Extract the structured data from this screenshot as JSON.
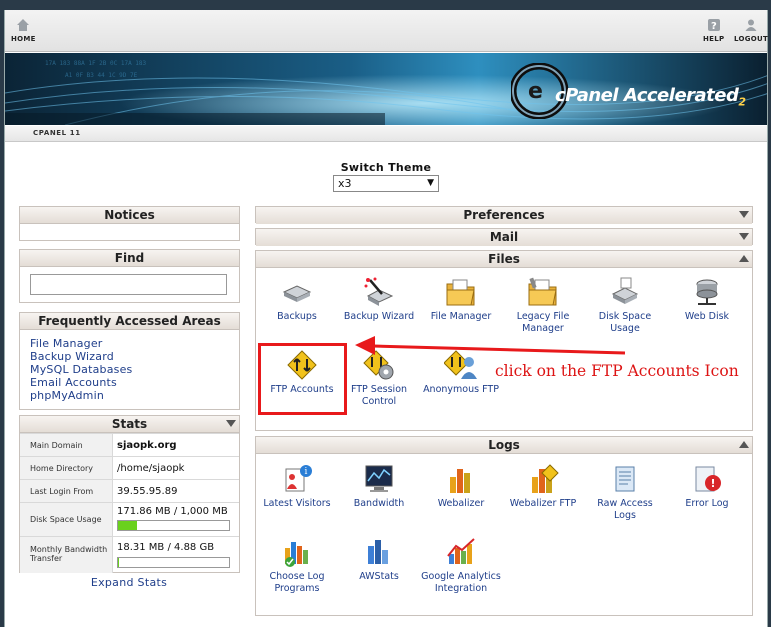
{
  "topbar": {
    "home_label": "HOME",
    "help_label": "HELP",
    "logout_label": "LOGOUT"
  },
  "banner": {
    "brand": "cPanel",
    "tagline": "Accelerated",
    "sub": "2"
  },
  "version_label": "CPANEL 11",
  "theme": {
    "label": "Switch Theme",
    "selected": "x3"
  },
  "notices": {
    "title": "Notices"
  },
  "find": {
    "title": "Find",
    "value": ""
  },
  "frequent": {
    "title": "Frequently Accessed Areas",
    "links": [
      "File Manager",
      "Backup Wizard",
      "MySQL Databases",
      "Email Accounts",
      "phpMyAdmin"
    ]
  },
  "stats": {
    "title": "Stats",
    "rows": [
      {
        "key": "Main Domain",
        "value": "sjaopk.org"
      },
      {
        "key": "Home Directory",
        "value": "/home/sjaopk"
      },
      {
        "key": "Last Login From",
        "value": "39.55.95.89"
      },
      {
        "key": "Disk Space Usage",
        "value": "171.86 MB / 1,000 MB",
        "usage_fraction": 0.17
      },
      {
        "key": "Monthly Bandwidth Transfer",
        "value": "18.31 MB / 4.88 GB",
        "usage_fraction": 0.004
      }
    ],
    "expand_label": "Expand Stats"
  },
  "sections": {
    "preferences": "Preferences",
    "mail": "Mail",
    "files": "Files",
    "logs": "Logs"
  },
  "files_icons": [
    {
      "label": "Backups",
      "icon": "backups-icon"
    },
    {
      "label": "Backup Wizard",
      "icon": "backup-wizard-icon"
    },
    {
      "label": "File Manager",
      "icon": "file-manager-icon"
    },
    {
      "label": "Legacy File Manager",
      "icon": "legacy-file-manager-icon"
    },
    {
      "label": "Disk Space Usage",
      "icon": "disk-space-usage-icon"
    },
    {
      "label": "Web Disk",
      "icon": "web-disk-icon"
    },
    {
      "label": "FTP Accounts",
      "icon": "ftp-accounts-icon"
    },
    {
      "label": "FTP Session Control",
      "icon": "ftp-session-control-icon"
    },
    {
      "label": "Anonymous FTP",
      "icon": "anonymous-ftp-icon"
    }
  ],
  "logs_icons": [
    {
      "label": "Latest Visitors",
      "icon": "latest-visitors-icon"
    },
    {
      "label": "Bandwidth",
      "icon": "bandwidth-icon"
    },
    {
      "label": "Webalizer",
      "icon": "webalizer-icon"
    },
    {
      "label": "Webalizer FTP",
      "icon": "webalizer-ftp-icon"
    },
    {
      "label": "Raw Access Logs",
      "icon": "raw-access-logs-icon"
    },
    {
      "label": "Error Log",
      "icon": "error-log-icon"
    },
    {
      "label": "Choose Log Programs",
      "icon": "choose-log-programs-icon"
    },
    {
      "label": "AWStats",
      "icon": "awstats-icon"
    },
    {
      "label": "Google Analytics Integration",
      "icon": "google-analytics-icon"
    }
  ],
  "annotation": {
    "text": "click on the FTP Accounts Icon",
    "color": "#e8191b"
  }
}
